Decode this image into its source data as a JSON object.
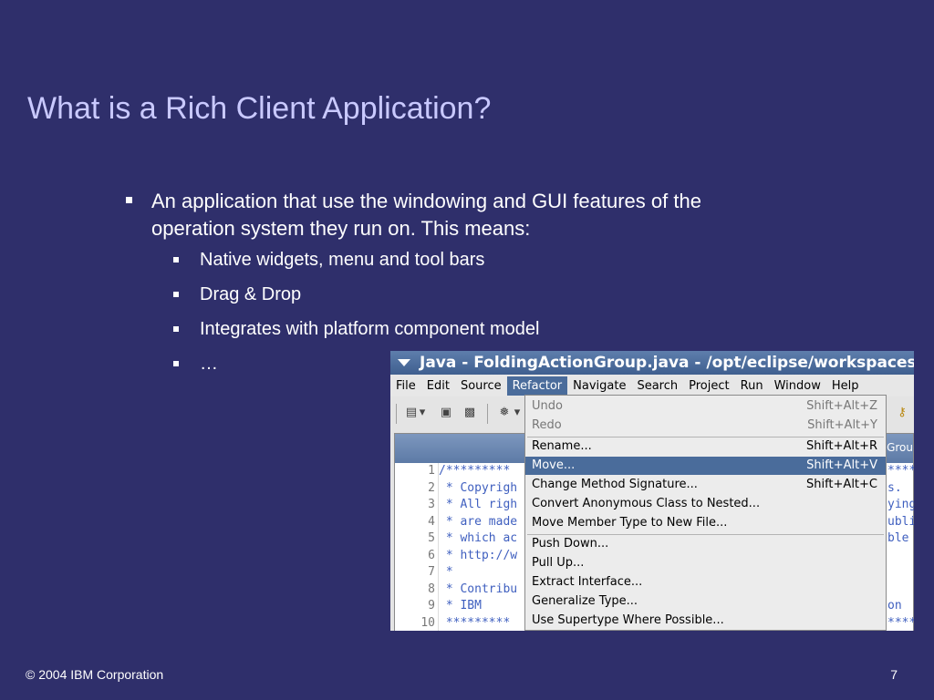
{
  "slide": {
    "title": "What is a Rich Client Application?",
    "bullet1_line1": "An application that use the windowing and GUI features of the",
    "bullet1_line2": "operation system they run on. This means:",
    "sub_bullets": [
      "Native widgets, menu and tool bars",
      "Drag & Drop",
      "Integrates with platform component model",
      "…"
    ],
    "footer_left": "© 2004 IBM Corporation",
    "page_number": "7"
  },
  "screenshot": {
    "window_title": "Java - FoldingActionGroup.java - /opt/eclipse/workspaces/bugf",
    "menus": [
      "File",
      "Edit",
      "Source",
      "Refactor",
      "Navigate",
      "Search",
      "Project",
      "Run",
      "Window",
      "Help"
    ],
    "active_menu": "Refactor",
    "tab_fragment": "Grou",
    "toolbar_icons": [
      "new-wizard-icon",
      "dropdown-arrow-icon",
      "save-icon",
      "print-icon",
      "debug-icon",
      "dropdown-arrow-icon",
      "key-icon"
    ],
    "code_lines": [
      {
        "n": "1",
        "t": "/*********",
        "r": "****"
      },
      {
        "n": "2",
        "t": " * Copyrigh",
        "r": "s."
      },
      {
        "n": "3",
        "t": " * All righ",
        "r": "ying"
      },
      {
        "n": "4",
        "t": " * are made",
        "r": "ubli"
      },
      {
        "n": "5",
        "t": " * which ac",
        "r": "ble"
      },
      {
        "n": "6",
        "t": " * http://w",
        "r": ""
      },
      {
        "n": "7",
        "t": " *",
        "r": ""
      },
      {
        "n": "8",
        "t": " * Contribu",
        "r": ""
      },
      {
        "n": "9",
        "t": " *     IBM",
        "r": "on"
      },
      {
        "n": "10",
        "t": " *********",
        "r": "****"
      }
    ],
    "refactor_menu": [
      {
        "label": "Undo",
        "shortcut": "Shift+Alt+Z",
        "disabled": true
      },
      {
        "label": "Redo",
        "shortcut": "Shift+Alt+Y",
        "disabled": true
      },
      {
        "label": "Rename...",
        "shortcut": "Shift+Alt+R"
      },
      {
        "label": "Move...",
        "shortcut": "Shift+Alt+V",
        "highlighted": true
      },
      {
        "label": "Change Method Signature...",
        "shortcut": "Shift+Alt+C"
      },
      {
        "label": "Convert Anonymous Class to Nested...",
        "shortcut": ""
      },
      {
        "label": "Move Member Type to New File...",
        "shortcut": ""
      },
      {
        "label": "Push Down...",
        "shortcut": ""
      },
      {
        "label": "Pull Up...",
        "shortcut": ""
      },
      {
        "label": "Extract Interface...",
        "shortcut": ""
      },
      {
        "label": "Generalize Type...",
        "shortcut": ""
      },
      {
        "label": "Use Supertype Where Possible...",
        "shortcut": ""
      }
    ]
  },
  "colors": {
    "background": "#2f2f6b",
    "title": "#c9c9ff",
    "menu_highlight": "#4a6c9b",
    "comment": "#3f5fbf"
  }
}
